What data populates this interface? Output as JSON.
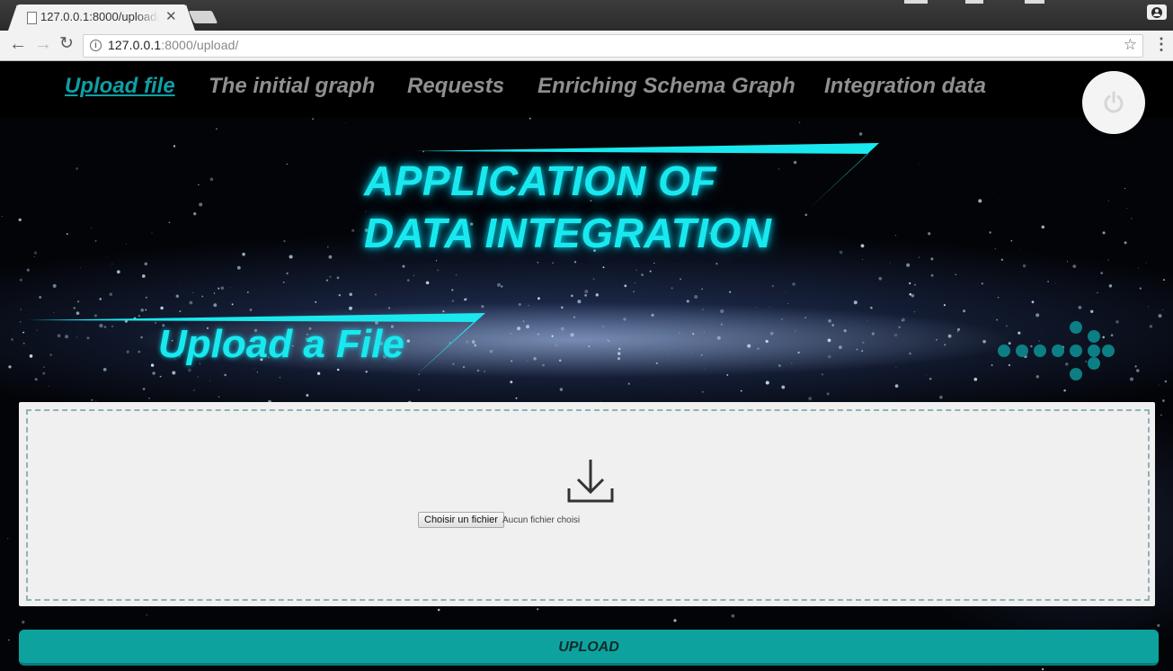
{
  "browser": {
    "tab_title": "127.0.0.1:8000/upload/",
    "url_host": "127.0.0.1",
    "url_path": ":8000/upload/"
  },
  "navbar": {
    "items": [
      {
        "label": "Upload file",
        "active": true
      },
      {
        "label": "The initial graph",
        "active": false
      },
      {
        "label": "Requests",
        "active": false
      },
      {
        "label": "Enriching Schema Graph",
        "active": false
      },
      {
        "label": "Integration data",
        "active": false
      }
    ]
  },
  "hero": {
    "title_line1": "APPLICATION OF",
    "title_line2": "DATA INTEGRATION",
    "subtitle": "Upload a File"
  },
  "upload": {
    "choose_button": "Choisir un fichier",
    "file_status": "Aucun fichier choisi",
    "submit_label": "UPLOAD"
  },
  "icons": {
    "power": "power-icon",
    "download": "download-icon",
    "arrow_dots": "arrow-dots-icon"
  },
  "colors": {
    "accent": "#19e9ef",
    "button": "#0ea29e",
    "active_link": "#0f9ea5",
    "nav_link": "#8f8f8f"
  }
}
